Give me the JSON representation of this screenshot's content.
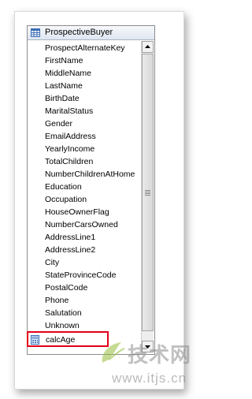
{
  "table": {
    "title": "ProspectiveBuyer",
    "icon": "table-icon",
    "columns": [
      "ProspectAlternateKey",
      "FirstName",
      "MiddleName",
      "LastName",
      "BirthDate",
      "MaritalStatus",
      "Gender",
      "EmailAddress",
      "YearlyIncome",
      "TotalChildren",
      "NumberChildrenAtHome",
      "Education",
      "Occupation",
      "HouseOwnerFlag",
      "NumberCarsOwned",
      "AddressLine1",
      "AddressLine2",
      "City",
      "StateProvinceCode",
      "PostalCode",
      "Phone",
      "Salutation",
      "Unknown"
    ],
    "calculated_column": {
      "label": "calcAge",
      "icon": "calculated-column-icon",
      "highlight_color": "#e3001b"
    }
  },
  "scrollbar": {
    "up_icon": "scroll-up-arrow-icon",
    "down_icon": "scroll-down-arrow-icon"
  },
  "watermark": {
    "logo_text": "技术网",
    "url": "www.itjs.cn"
  }
}
